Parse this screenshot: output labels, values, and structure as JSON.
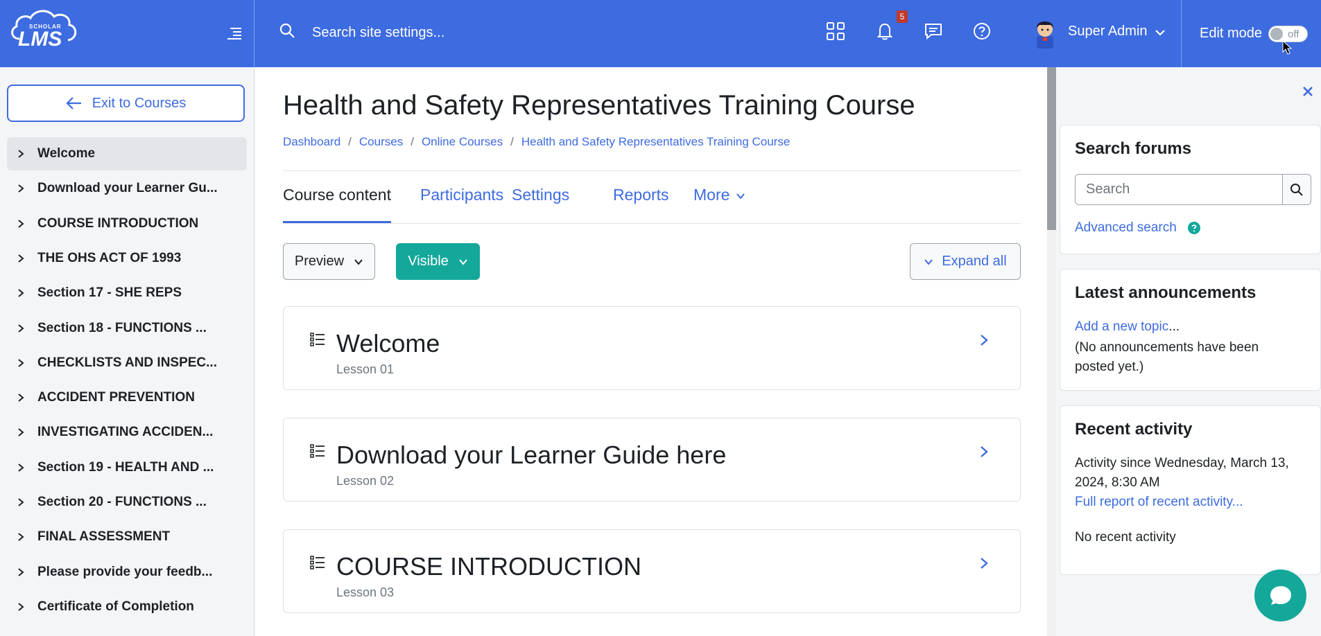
{
  "navbar": {
    "logo_small": "SCHOLAR",
    "logo_big": "LMS",
    "search_placeholder": "Search site settings...",
    "notification_count": "5",
    "user_name": "Super Admin",
    "edit_mode_label": "Edit mode",
    "edit_mode_state": "off",
    "icons": [
      "hamburger-icon",
      "search-icon",
      "grid-icon",
      "bell-icon",
      "chat-icon",
      "help-icon",
      "chevron-down-icon"
    ],
    "brand_color": "#3d6be0"
  },
  "course_index": {
    "exit_label": "Exit to Courses",
    "items": [
      {
        "label": "Welcome",
        "active": true
      },
      {
        "label": "Download your Learner Gu..."
      },
      {
        "label": "COURSE INTRODUCTION"
      },
      {
        "label": "THE OHS ACT OF 1993"
      },
      {
        "label": "Section 17 - SHE REPS"
      },
      {
        "label": "Section 18 - FUNCTIONS ..."
      },
      {
        "label": "CHECKLISTS AND INSPEC..."
      },
      {
        "label": "ACCIDENT PREVENTION"
      },
      {
        "label": "INVESTIGATING ACCIDEN..."
      },
      {
        "label": "Section 19 - HEALTH AND ..."
      },
      {
        "label": "Section 20 - FUNCTIONS ..."
      },
      {
        "label": "FINAL ASSESSMENT"
      },
      {
        "label": "Please provide your feedb..."
      },
      {
        "label": "Certificate of Completion"
      }
    ]
  },
  "main": {
    "title": "Health and Safety Representatives Training Course",
    "breadcrumb": [
      "Dashboard",
      "Courses",
      "Online Courses",
      "Health and Safety Representatives Training Course"
    ],
    "tabs": [
      "Course content",
      "Participants",
      "Settings",
      "Reports",
      "More"
    ],
    "preview_label": "Preview",
    "visible_label": "Visible",
    "expand_label": "Expand all",
    "sections": [
      {
        "title": "Welcome",
        "subtitle": "Lesson 01"
      },
      {
        "title": "Download your Learner Guide here",
        "subtitle": "Lesson 02"
      },
      {
        "title": "COURSE INTRODUCTION",
        "subtitle": "Lesson 03"
      }
    ]
  },
  "blocks": {
    "search_forums": {
      "title": "Search forums",
      "placeholder": "Search",
      "advanced_link": "Advanced search"
    },
    "announcements": {
      "title": "Latest announcements",
      "add_link": "Add a new topic",
      "add_suffix": "...",
      "empty_text": "(No announcements have been posted yet.)"
    },
    "recent_activity": {
      "title": "Recent activity",
      "since_text": "Activity since Wednesday, March 13, 2024, 8:30 AM",
      "full_report_link": "Full report of recent activity...",
      "empty_text": "No recent activity"
    }
  },
  "accent_colors": {
    "primary": "#3d6be0",
    "teal": "#14a89b",
    "badge": "#c0392b"
  }
}
